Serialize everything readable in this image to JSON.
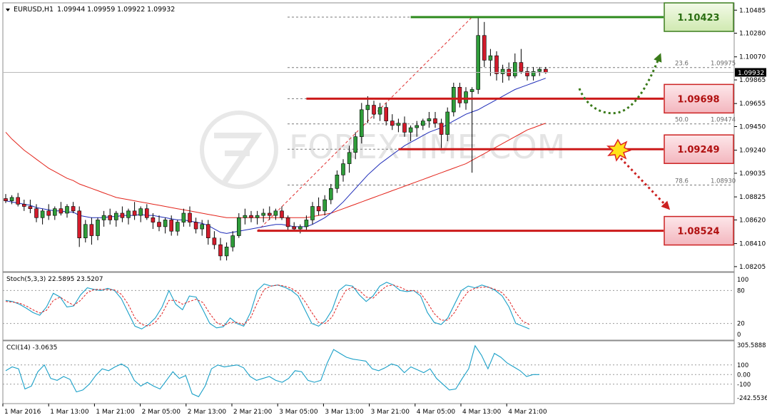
{
  "chart_data": {
    "type": "candlestick",
    "symbol_label": "EURUSD,H1",
    "ohlc_header": [
      "1.09944",
      "1.09959",
      "1.09922",
      "1.09932"
    ],
    "watermark": "FOREXTIME.COM",
    "price_axis": {
      "range": [
        1.0816,
        1.1055
      ],
      "ticks": [
        "1.10485",
        "1.10280",
        "1.10070",
        "1.09865",
        "1.09655",
        "1.09450",
        "1.09240",
        "1.09035",
        "1.08825",
        "1.08620",
        "1.08410",
        "1.08205"
      ],
      "current_price": "1.09932"
    },
    "time_axis": {
      "labels": [
        "1 Mar 2016",
        "1 Mar 13:00",
        "1 Mar 21:00",
        "2 Mar 05:00",
        "2 Mar 13:00",
        "2 Mar 21:00",
        "3 Mar 05:00",
        "3 Mar 13:00",
        "3 Mar 21:00",
        "4 Mar 05:00",
        "4 Mar 13:00",
        "4 Mar 21:00"
      ]
    },
    "candles": [
      [
        1.0881,
        1.0885,
        1.0877,
        1.0879
      ],
      [
        1.0879,
        1.0884,
        1.0876,
        1.0882
      ],
      [
        1.0882,
        1.0886,
        1.0874,
        1.0876
      ],
      [
        1.0876,
        1.088,
        1.087,
        1.0874
      ],
      [
        1.0874,
        1.088,
        1.0868,
        1.0872
      ],
      [
        1.0872,
        1.0876,
        1.086,
        1.0864
      ],
      [
        1.0864,
        1.0872,
        1.0858,
        1.087
      ],
      [
        1.087,
        1.0876,
        1.0862,
        1.0866
      ],
      [
        1.0866,
        1.0874,
        1.0862,
        1.0872
      ],
      [
        1.0872,
        1.0878,
        1.0866,
        1.0868
      ],
      [
        1.0868,
        1.0876,
        1.0864,
        1.0874
      ],
      [
        1.0874,
        1.0878,
        1.0868,
        1.087
      ],
      [
        1.087,
        1.0874,
        1.0838,
        1.0846
      ],
      [
        1.0846,
        1.0862,
        1.0842,
        1.0858
      ],
      [
        1.0858,
        1.0864,
        1.084,
        1.0848
      ],
      [
        1.0848,
        1.0864,
        1.0844,
        1.0862
      ],
      [
        1.0862,
        1.087,
        1.0856,
        1.0866
      ],
      [
        1.0866,
        1.0872,
        1.0858,
        1.0862
      ],
      [
        1.0862,
        1.087,
        1.0856,
        1.0868
      ],
      [
        1.0868,
        1.0874,
        1.086,
        1.0864
      ],
      [
        1.0864,
        1.0872,
        1.0858,
        1.087
      ],
      [
        1.087,
        1.0878,
        1.0862,
        1.0866
      ],
      [
        1.0866,
        1.0874,
        1.086,
        1.0872
      ],
      [
        1.0872,
        1.0876,
        1.0862,
        1.0864
      ],
      [
        1.0864,
        1.0868,
        1.0854,
        1.086
      ],
      [
        1.086,
        1.0866,
        1.0852,
        1.0856
      ],
      [
        1.0856,
        1.0864,
        1.085,
        1.0862
      ],
      [
        1.0862,
        1.0866,
        1.0848,
        1.0852
      ],
      [
        1.0852,
        1.0862,
        1.0848,
        1.086
      ],
      [
        1.086,
        1.0872,
        1.0856,
        1.0868
      ],
      [
        1.0868,
        1.0874,
        1.0856,
        1.086
      ],
      [
        1.086,
        1.0864,
        1.085,
        1.0854
      ],
      [
        1.0854,
        1.0862,
        1.0848,
        1.0858
      ],
      [
        1.0858,
        1.0862,
        1.084,
        1.0846
      ],
      [
        1.0846,
        1.0852,
        1.0836,
        1.084
      ],
      [
        1.084,
        1.0846,
        1.0826,
        1.083
      ],
      [
        1.083,
        1.0842,
        1.0826,
        1.0838
      ],
      [
        1.0838,
        1.0852,
        1.0834,
        1.0848
      ],
      [
        1.0848,
        1.0868,
        1.0846,
        1.0864
      ],
      [
        1.0864,
        1.0872,
        1.0858,
        1.0866
      ],
      [
        1.0866,
        1.087,
        1.086,
        1.0864
      ],
      [
        1.0864,
        1.087,
        1.0858,
        1.0866
      ],
      [
        1.0866,
        1.0872,
        1.086,
        1.0868
      ],
      [
        1.0868,
        1.0874,
        1.0862,
        1.0866
      ],
      [
        1.0866,
        1.0872,
        1.0862,
        1.087
      ],
      [
        1.087,
        1.0874,
        1.0862,
        1.0864
      ],
      [
        1.0864,
        1.0866,
        1.0852,
        1.0856
      ],
      [
        1.0856,
        1.086,
        1.0852,
        1.0854
      ],
      [
        1.0854,
        1.0858,
        1.085,
        1.0856
      ],
      [
        1.0856,
        1.0866,
        1.0852,
        1.0862
      ],
      [
        1.0862,
        1.0878,
        1.0858,
        1.0874
      ],
      [
        1.0874,
        1.0882,
        1.0866,
        1.087
      ],
      [
        1.087,
        1.0884,
        1.0866,
        1.088
      ],
      [
        1.088,
        1.0894,
        1.0876,
        1.089
      ],
      [
        1.089,
        1.0906,
        1.0886,
        1.0902
      ],
      [
        1.0902,
        1.0916,
        1.0896,
        1.0912
      ],
      [
        1.0912,
        1.0928,
        1.0904,
        1.0922
      ],
      [
        1.0922,
        1.094,
        1.0916,
        1.0936
      ],
      [
        1.0936,
        1.0966,
        1.093,
        1.096
      ],
      [
        1.096,
        1.0972,
        1.0948,
        1.0964
      ],
      [
        1.0964,
        1.0968,
        1.0952,
        1.0956
      ],
      [
        1.0956,
        1.0966,
        1.095,
        1.0962
      ],
      [
        1.0962,
        1.0966,
        1.0946,
        1.095
      ],
      [
        1.095,
        1.0956,
        1.0942,
        1.0946
      ],
      [
        1.0946,
        1.0952,
        1.094,
        1.0948
      ],
      [
        1.0948,
        1.0954,
        1.0936,
        1.094
      ],
      [
        1.094,
        1.0946,
        1.0932,
        1.0944
      ],
      [
        1.0944,
        1.095,
        1.0936,
        1.0946
      ],
      [
        1.0946,
        1.0952,
        1.0942,
        1.095
      ],
      [
        1.095,
        1.0958,
        1.0944,
        1.0952
      ],
      [
        1.0952,
        1.0958,
        1.0944,
        1.0948
      ],
      [
        1.0948,
        1.0952,
        1.0926,
        1.0938
      ],
      [
        1.0938,
        1.0962,
        1.0932,
        1.0958
      ],
      [
        1.0958,
        1.0984,
        1.0954,
        1.098
      ],
      [
        1.098,
        1.0984,
        1.0962,
        1.0966
      ],
      [
        1.0966,
        1.098,
        1.096,
        1.0976
      ],
      [
        1.0976,
        1.098,
        1.0904,
        1.0978
      ],
      [
        1.0978,
        1.1042,
        1.0974,
        1.1026
      ],
      [
        1.1026,
        1.1038,
        1.0998,
        1.1004
      ],
      [
        1.1004,
        1.1014,
        1.099,
        1.1008
      ],
      [
        1.1008,
        1.1012,
        1.0986,
        1.0992
      ],
      [
        1.0992,
        1.1,
        1.0984,
        1.0996
      ],
      [
        1.0996,
        1.1002,
        1.0986,
        1.099
      ],
      [
        1.099,
        1.101,
        1.0988,
        1.1002
      ],
      [
        1.1002,
        1.1014,
        1.0992,
        1.0994
      ],
      [
        1.0994,
        1.0998,
        1.0986,
        1.099
      ],
      [
        1.099,
        1.0998,
        1.0986,
        1.0994
      ],
      [
        1.0994,
        1.0998,
        1.099,
        1.0996
      ],
      [
        1.0996,
        1.0998,
        1.0992,
        1.0993
      ]
    ],
    "ma_slow": [
      1.094,
      1.0934,
      1.0929,
      1.0924,
      1.092,
      1.0916,
      1.0912,
      1.0908,
      1.0905,
      1.0902,
      1.0899,
      1.0897,
      1.0894,
      1.0892,
      1.089,
      1.0888,
      1.0886,
      1.0884,
      1.0882,
      1.0881,
      1.088,
      1.0879,
      1.0878,
      1.0877,
      1.0876,
      1.0875,
      1.0874,
      1.0873,
      1.0872,
      1.0871,
      1.087,
      1.0869,
      1.0868,
      1.0867,
      1.0866,
      1.0865,
      1.0864,
      1.0864,
      1.0864,
      1.0864,
      1.0864,
      1.0864,
      1.0864,
      1.0864,
      1.0864,
      1.0864,
      1.0864,
      1.0864,
      1.0864,
      1.0864,
      1.0865,
      1.0866,
      1.0867,
      1.0868,
      1.087,
      1.0872,
      1.0874,
      1.0876,
      1.0878,
      1.088,
      1.0882,
      1.0884,
      1.0886,
      1.0888,
      1.089,
      1.0892,
      1.0894,
      1.0896,
      1.0898,
      1.09,
      1.0902,
      1.0904,
      1.0906,
      1.0908,
      1.091,
      1.0912,
      1.0915,
      1.0918,
      1.0921,
      1.0924,
      1.0927,
      1.093,
      1.0933,
      1.0936,
      1.0939,
      1.0942,
      1.0944,
      1.0946,
      1.0948
    ],
    "ma_fast": [
      1.0879,
      1.0878,
      1.0877,
      1.0876,
      1.0875,
      1.0873,
      1.0872,
      1.0871,
      1.087,
      1.087,
      1.0869,
      1.0869,
      1.0866,
      1.0865,
      1.0864,
      1.0864,
      1.0864,
      1.0865,
      1.0865,
      1.0866,
      1.0866,
      1.0866,
      1.0867,
      1.0866,
      1.0866,
      1.0865,
      1.0864,
      1.0863,
      1.0862,
      1.0862,
      1.0861,
      1.086,
      1.0859,
      1.0857,
      1.0854,
      1.0851,
      1.085,
      1.0851,
      1.0852,
      1.0853,
      1.0854,
      1.0855,
      1.0856,
      1.0857,
      1.0858,
      1.0858,
      1.0857,
      1.0856,
      1.0856,
      1.0856,
      1.0858,
      1.0861,
      1.0864,
      1.0868,
      1.0873,
      1.0878,
      1.0884,
      1.089,
      1.0896,
      1.0902,
      1.0907,
      1.0912,
      1.0916,
      1.092,
      1.0924,
      1.0928,
      1.0931,
      1.0934,
      1.0937,
      1.094,
      1.0942,
      1.0944,
      1.0947,
      1.095,
      1.0953,
      1.0956,
      1.0958,
      1.096,
      1.0963,
      1.0966,
      1.0969,
      1.0972,
      1.0975,
      1.0978,
      1.098,
      1.0982,
      1.0984,
      1.0986,
      1.0988
    ],
    "levels": [
      {
        "label": "1.10423",
        "value": 1.10423,
        "kind": "resistance",
        "from_index": 66
      },
      {
        "label": "1.09698",
        "value": 1.09698,
        "kind": "resistance",
        "from_index": 49
      },
      {
        "label": "1.09249",
        "value": 1.09249,
        "kind": "pivot",
        "from_index": 64
      },
      {
        "label": "1.08524",
        "value": 1.08524,
        "kind": "support",
        "from_index": 41
      }
    ],
    "fibonacci": [
      {
        "ratio": "23.6",
        "price": "1.09975",
        "value": 1.09975
      },
      {
        "ratio": "50.0",
        "price": "1.09474",
        "value": 1.09474
      },
      {
        "ratio": "78.6",
        "price": "1.08930",
        "value": 1.0893
      }
    ],
    "fib_unlabeled_levels": [
      1.10423,
      1.09698,
      1.09249
    ],
    "stochastic": {
      "label": "Stoch(5,3,3) 22.5895 23.5207",
      "ticks": [
        "100",
        "80",
        "20",
        "0"
      ],
      "k": [
        62,
        60,
        55,
        48,
        40,
        35,
        50,
        75,
        68,
        50,
        52,
        72,
        85,
        82,
        80,
        84,
        80,
        65,
        40,
        15,
        10,
        18,
        30,
        50,
        80,
        55,
        45,
        70,
        68,
        45,
        20,
        12,
        14,
        30,
        20,
        15,
        40,
        80,
        92,
        88,
        90,
        86,
        80,
        70,
        45,
        20,
        15,
        25,
        45,
        80,
        90,
        88,
        72,
        60,
        70,
        88,
        95,
        90,
        80,
        78,
        80,
        70,
        40,
        22,
        18,
        30,
        55,
        80,
        88,
        85,
        90,
        86,
        80,
        70,
        50,
        20,
        15,
        10
      ],
      "d": [
        60,
        59,
        57,
        52,
        45,
        39,
        44,
        62,
        68,
        60,
        53,
        62,
        76,
        82,
        82,
        82,
        81,
        73,
        55,
        30,
        18,
        15,
        22,
        38,
        62,
        62,
        55,
        60,
        64,
        58,
        38,
        22,
        16,
        22,
        22,
        18,
        30,
        58,
        82,
        88,
        90,
        88,
        84,
        76,
        60,
        40,
        22,
        20,
        32,
        58,
        80,
        86,
        80,
        68,
        66,
        78,
        88,
        90,
        86,
        80,
        80,
        75,
        58,
        38,
        26,
        26,
        40,
        62,
        78,
        84,
        86,
        86,
        82,
        76,
        62,
        40,
        24,
        18
      ]
    },
    "cci": {
      "label": "CCI(14) -3.0635",
      "ticks": [
        "305.5888",
        "100",
        "0.00",
        "-100",
        "-242.5536"
      ],
      "values": [
        40,
        80,
        60,
        -150,
        -120,
        30,
        100,
        -40,
        -60,
        -20,
        -50,
        -180,
        -160,
        -100,
        -10,
        60,
        40,
        80,
        110,
        70,
        -60,
        -120,
        -80,
        -120,
        -150,
        -60,
        30,
        -40,
        -10,
        -200,
        -230,
        -120,
        60,
        100,
        80,
        90,
        100,
        70,
        -20,
        -60,
        -40,
        -20,
        -60,
        -80,
        -40,
        40,
        30,
        -60,
        -80,
        -60,
        120,
        260,
        220,
        180,
        160,
        150,
        140,
        60,
        40,
        70,
        110,
        90,
        20,
        80,
        50,
        20,
        60,
        -40,
        -100,
        -160,
        -150,
        -40,
        60,
        300,
        200,
        60,
        220,
        180,
        120,
        80,
        40,
        -20,
        0,
        0
      ]
    }
  }
}
